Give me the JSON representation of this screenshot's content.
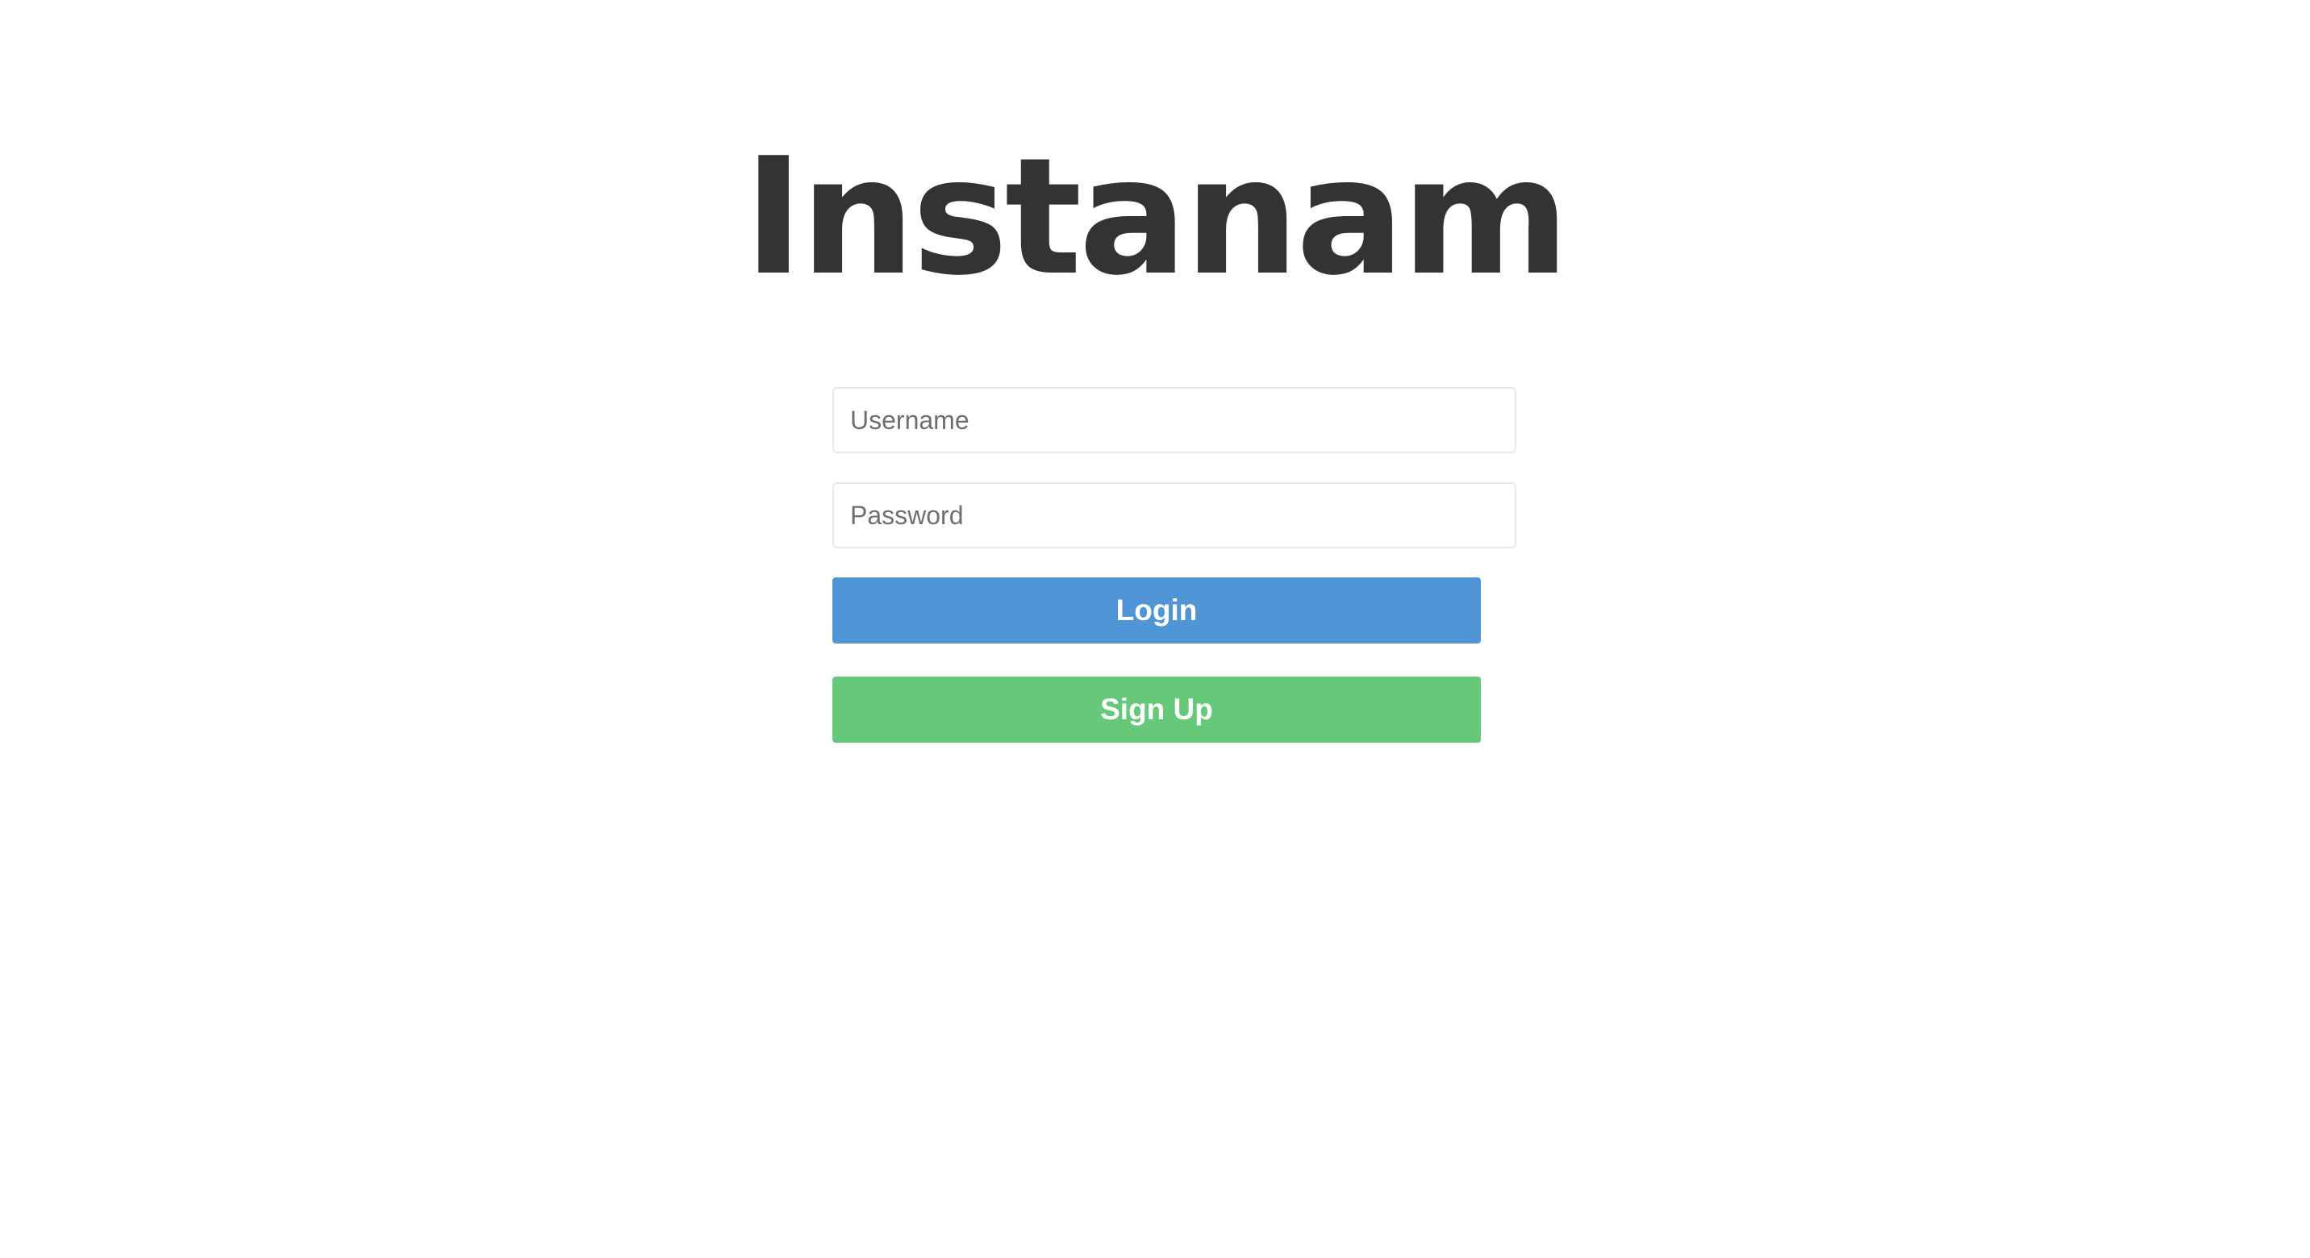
{
  "brand": {
    "logo_text": "Instanam"
  },
  "login_form": {
    "username_placeholder": "Username",
    "username_value": "",
    "password_placeholder": "Password",
    "password_value": "",
    "login_label": "Login",
    "signup_label": "Sign Up"
  },
  "colors": {
    "background": "#ffffff",
    "logo_text": "#333333",
    "login_button": "#5096d6",
    "signup_button": "#66c979",
    "input_border": "#e8e8e8"
  }
}
